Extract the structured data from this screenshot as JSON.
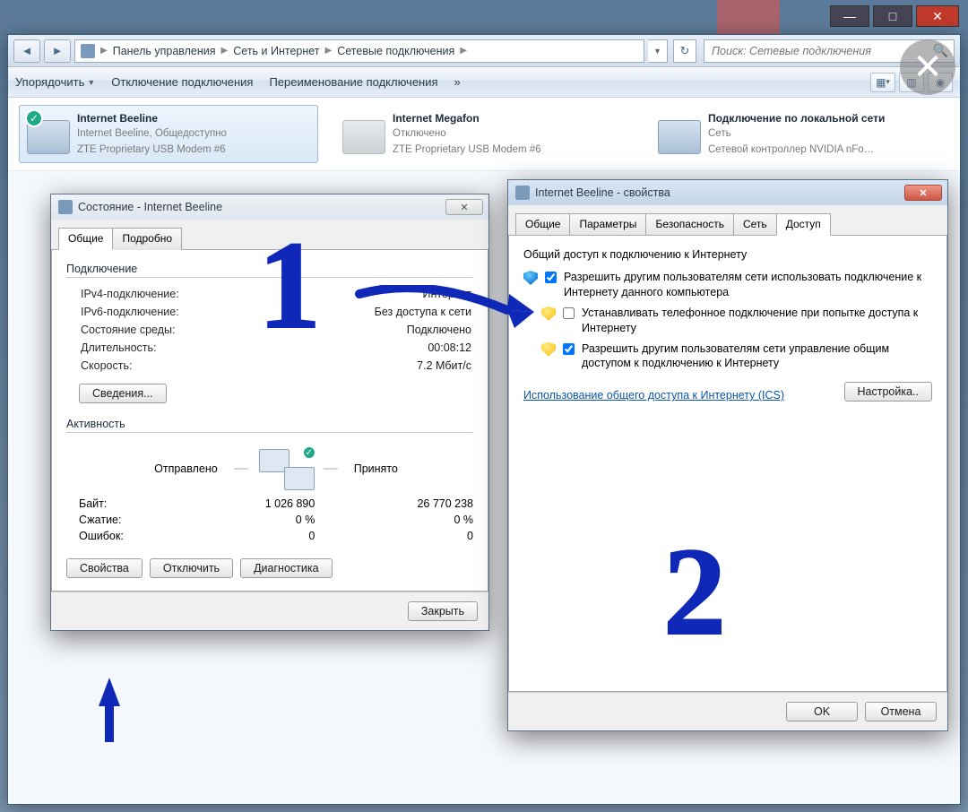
{
  "breadcrumb": {
    "parts": [
      "Панель управления",
      "Сеть и Интернет",
      "Сетевые подключения"
    ]
  },
  "search": {
    "placeholder": "Поиск: Сетевые подключения"
  },
  "toolbar": {
    "organize": "Упорядочить",
    "disable": "Отключение подключения",
    "rename": "Переименование подключения",
    "more": "»"
  },
  "connections": [
    {
      "name": "Internet Beeline",
      "line2": "Internet Beeline, Общедоступно",
      "line3": "ZTE Proprietary USB Modem #6",
      "selected": true,
      "off": false
    },
    {
      "name": "Internet Megafon",
      "line2": "Отключено",
      "line3": "ZTE Proprietary USB Modem #6",
      "selected": false,
      "off": true
    },
    {
      "name": "Подключение по локальной сети",
      "line2": "Сеть",
      "line3": "Сетевой контроллер NVIDIA nFo…",
      "selected": false,
      "off": false
    }
  ],
  "status_dialog": {
    "title": "Состояние - Internet Beeline",
    "tabs": {
      "general": "Общие",
      "details": "Подробно"
    },
    "group_conn": "Подключение",
    "ipv4_k": "IPv4-подключение:",
    "ipv4_v": "Интернет",
    "ipv6_k": "IPv6-подключение:",
    "ipv6_v": "Без доступа к сети",
    "media_k": "Состояние среды:",
    "media_v": "Подключено",
    "dur_k": "Длительность:",
    "dur_v": "00:08:12",
    "spd_k": "Скорость:",
    "spd_v": "7.2 Мбит/с",
    "details_btn": "Сведения...",
    "group_act": "Активность",
    "sent": "Отправлено",
    "recv": "Принято",
    "bytes_k": "Байт:",
    "bytes_s": "1 026 890",
    "bytes_r": "26 770 238",
    "comp_k": "Сжатие:",
    "comp_s": "0 %",
    "comp_r": "0 %",
    "err_k": "Ошибок:",
    "err_s": "0",
    "err_r": "0",
    "props_btn": "Свойства",
    "disc_btn": "Отключить",
    "diag_btn": "Диагностика",
    "close_btn": "Закрыть"
  },
  "props_dialog": {
    "title": "Internet Beeline - свойства",
    "tabs": {
      "general": "Общие",
      "params": "Параметры",
      "security": "Безопасность",
      "net": "Сеть",
      "share": "Доступ"
    },
    "group": "Общий доступ к подключению к Интернету",
    "chk1": "Разрешить другим пользователям сети использовать подключение к Интернету данного компьютера",
    "chk2": "Устанавливать телефонное подключение при попытке доступа к Интернету",
    "chk3": "Разрешить другим пользователям сети управление общим доступом к подключению к Интернету",
    "link": "Использование общего доступа к Интернету (ICS)",
    "settings_btn": "Настройка..",
    "ok": "OK",
    "cancel": "Отмена"
  }
}
